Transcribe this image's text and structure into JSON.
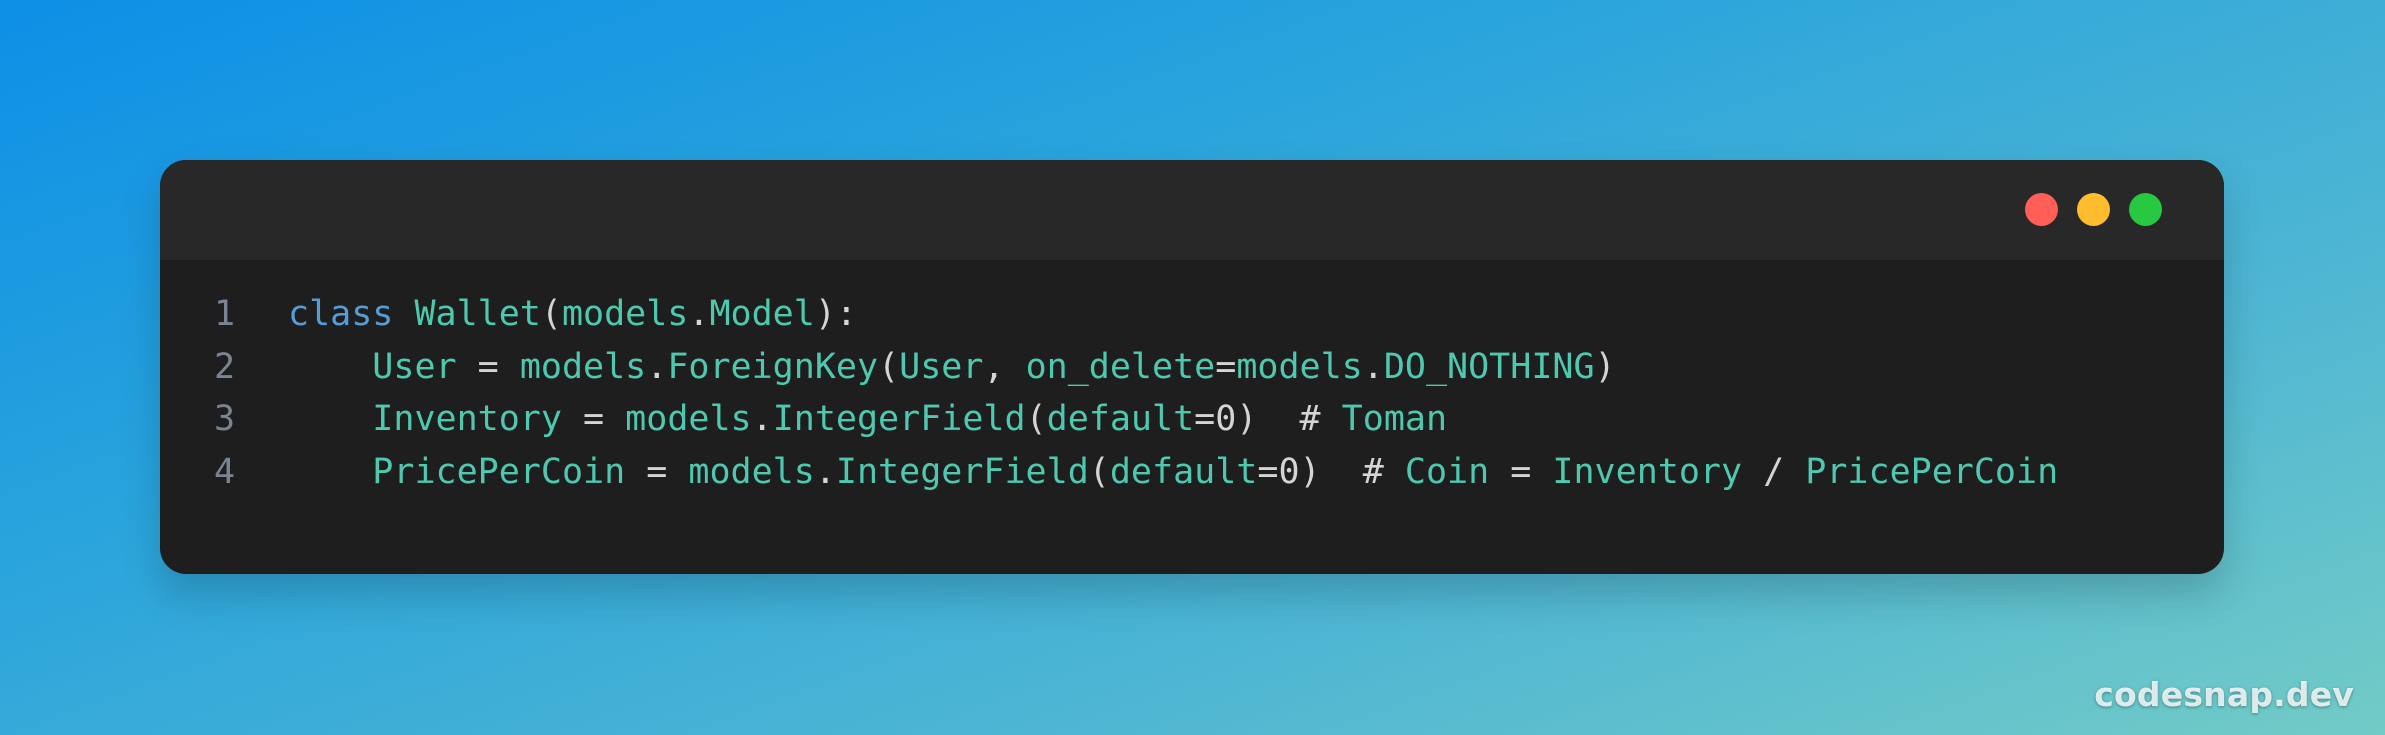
{
  "window": {
    "buttons": [
      {
        "name": "close",
        "color": "#ff5f57"
      },
      {
        "name": "minimize",
        "color": "#febc2e"
      },
      {
        "name": "zoom",
        "color": "#28c840"
      }
    ]
  },
  "colors": {
    "keyword": "#569cd6",
    "identifier": "#4ec9b0",
    "plain": "#d4d4d4",
    "line_number": "#7a8593"
  },
  "code": {
    "lines": [
      {
        "number": "1",
        "tokens": [
          {
            "text": "class",
            "kind": "keyword"
          },
          {
            "text": " ",
            "kind": "plain"
          },
          {
            "text": "Wallet",
            "kind": "identifier"
          },
          {
            "text": "(",
            "kind": "plain"
          },
          {
            "text": "models",
            "kind": "identifier"
          },
          {
            "text": ".",
            "kind": "plain"
          },
          {
            "text": "Model",
            "kind": "identifier"
          },
          {
            "text": "):",
            "kind": "plain"
          }
        ]
      },
      {
        "number": "2",
        "tokens": [
          {
            "text": "    ",
            "kind": "plain"
          },
          {
            "text": "User",
            "kind": "identifier"
          },
          {
            "text": " = ",
            "kind": "plain"
          },
          {
            "text": "models",
            "kind": "identifier"
          },
          {
            "text": ".",
            "kind": "plain"
          },
          {
            "text": "ForeignKey",
            "kind": "identifier"
          },
          {
            "text": "(",
            "kind": "plain"
          },
          {
            "text": "User",
            "kind": "identifier"
          },
          {
            "text": ", ",
            "kind": "plain"
          },
          {
            "text": "on_delete",
            "kind": "identifier"
          },
          {
            "text": "=",
            "kind": "plain"
          },
          {
            "text": "models",
            "kind": "identifier"
          },
          {
            "text": ".",
            "kind": "plain"
          },
          {
            "text": "DO_NOTHING",
            "kind": "identifier"
          },
          {
            "text": ")",
            "kind": "plain"
          }
        ]
      },
      {
        "number": "3",
        "tokens": [
          {
            "text": "    ",
            "kind": "plain"
          },
          {
            "text": "Inventory",
            "kind": "identifier"
          },
          {
            "text": " = ",
            "kind": "plain"
          },
          {
            "text": "models",
            "kind": "identifier"
          },
          {
            "text": ".",
            "kind": "plain"
          },
          {
            "text": "IntegerField",
            "kind": "identifier"
          },
          {
            "text": "(",
            "kind": "plain"
          },
          {
            "text": "default",
            "kind": "identifier"
          },
          {
            "text": "=0)  # ",
            "kind": "plain"
          },
          {
            "text": "Toman",
            "kind": "identifier"
          }
        ]
      },
      {
        "number": "4",
        "tokens": [
          {
            "text": "    ",
            "kind": "plain"
          },
          {
            "text": "PricePerCoin",
            "kind": "identifier"
          },
          {
            "text": " = ",
            "kind": "plain"
          },
          {
            "text": "models",
            "kind": "identifier"
          },
          {
            "text": ".",
            "kind": "plain"
          },
          {
            "text": "IntegerField",
            "kind": "identifier"
          },
          {
            "text": "(",
            "kind": "plain"
          },
          {
            "text": "default",
            "kind": "identifier"
          },
          {
            "text": "=0)  # ",
            "kind": "plain"
          },
          {
            "text": "Coin",
            "kind": "identifier"
          },
          {
            "text": " = ",
            "kind": "plain"
          },
          {
            "text": "Inventory",
            "kind": "identifier"
          },
          {
            "text": " / ",
            "kind": "plain"
          },
          {
            "text": "PricePerCoin",
            "kind": "identifier"
          }
        ]
      }
    ]
  },
  "watermark": "codesnap.dev"
}
